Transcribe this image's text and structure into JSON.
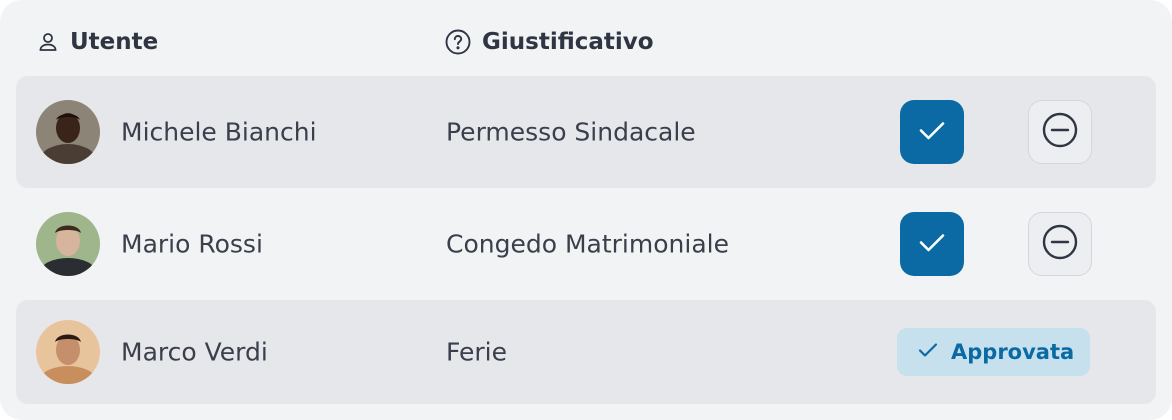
{
  "header": {
    "user_label": "Utente",
    "justification_label": "Giustificativo"
  },
  "rows": [
    {
      "name": "Michele Bianchi",
      "reason": "Permesso Sindacale",
      "status": "pending"
    },
    {
      "name": "Mario Rossi",
      "reason": "Congedo Matrimoniale",
      "status": "pending"
    },
    {
      "name": "Marco Verdi",
      "reason": "Ferie",
      "status": "approved",
      "status_label": "Approvata"
    }
  ],
  "colors": {
    "accent": "#0b6aa4",
    "badge_bg": "#c7e0ee",
    "row_shade": "#e6e7ea",
    "card_bg": "#f2f3f5",
    "text": "#3a3f4b"
  },
  "icons": {
    "header_user": "user-icon",
    "header_justification": "help-circle-icon",
    "approve": "check-icon",
    "reject": "minus-circle-icon",
    "approved": "check-icon"
  }
}
